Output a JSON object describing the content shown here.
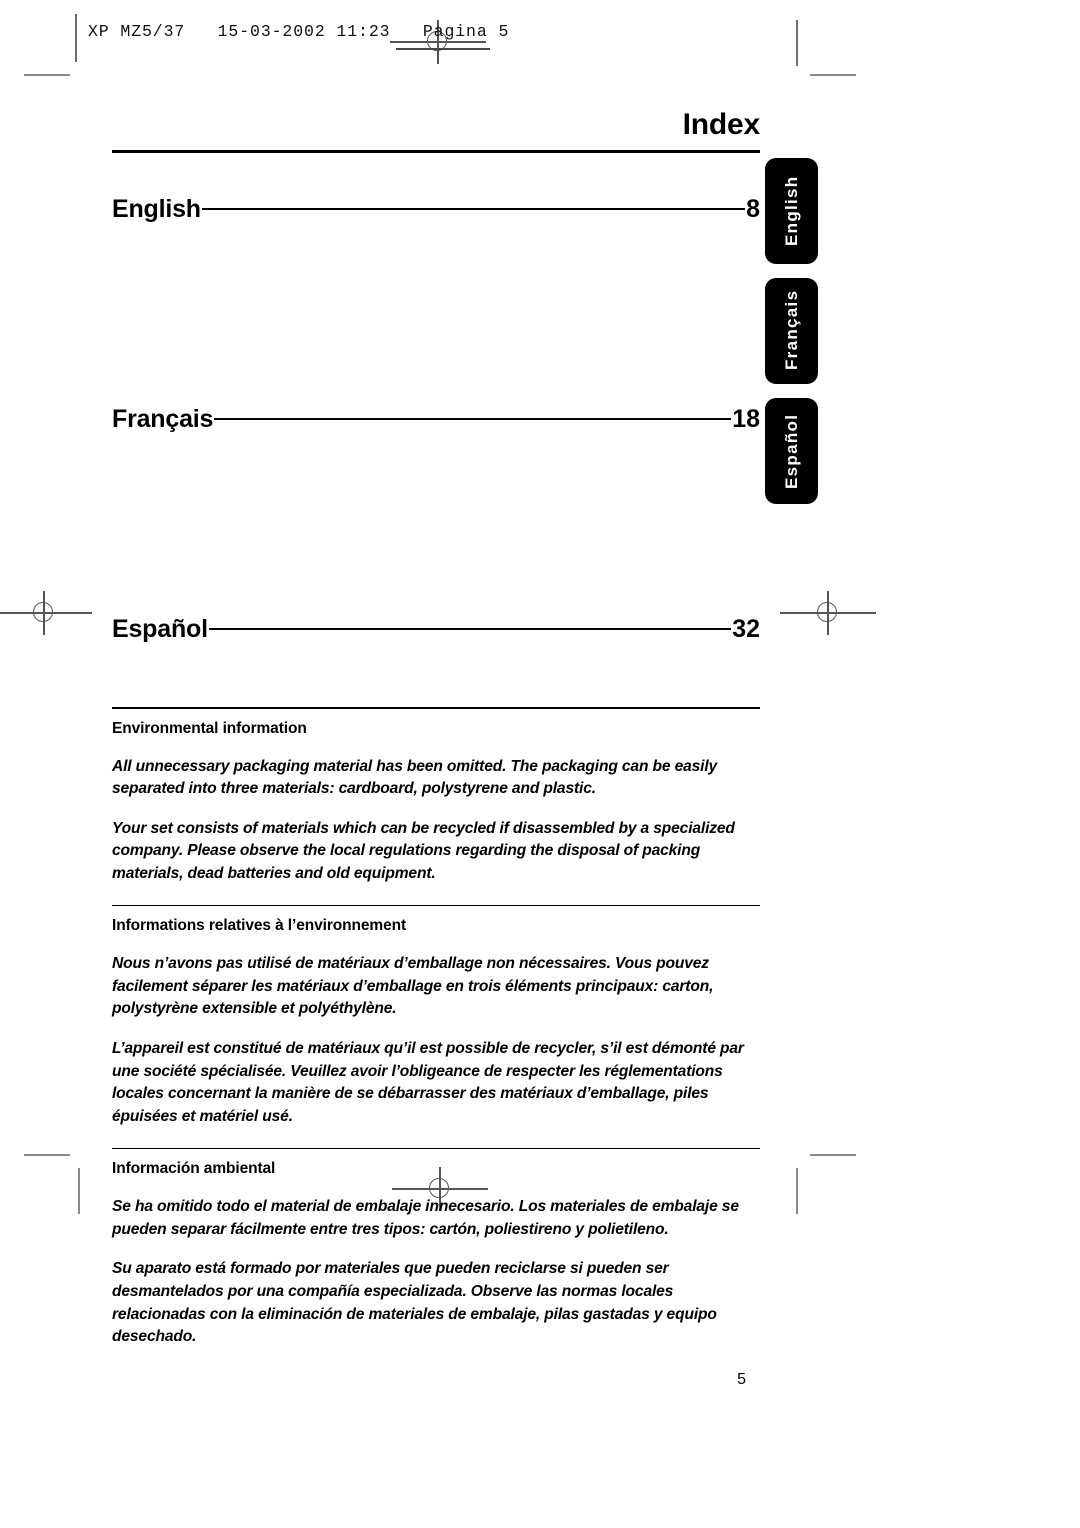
{
  "print_slug": {
    "text": "XP MZ5/37   15-03-2002 11:23   Pagina 5"
  },
  "page": {
    "title": "Index",
    "page_number": "5"
  },
  "toc": {
    "entries": [
      {
        "label": "English",
        "page": "8"
      },
      {
        "label": "Français",
        "page": "18"
      },
      {
        "label": "Español",
        "page": "32"
      }
    ]
  },
  "sections": [
    {
      "heading": "Environmental information",
      "paragraphs": [
        "All unnecessary packaging material has been omitted. The packaging can be easily separated into three materials: cardboard, polystyrene and plastic.",
        "Your set consists of materials which can be recycled if disassembled by a specialized company. Please observe the local regulations regarding the disposal of packing materials, dead batteries and old equipment."
      ]
    },
    {
      "heading": "Informations relatives à l’environnement",
      "paragraphs": [
        "Nous n’avons pas utilisé de matériaux d’emballage non nécessaires. Vous pouvez facilement séparer les matériaux d’emballage en trois éléments principaux: carton, polystyrène extensible et polyéthylène.",
        "L’appareil est constitué de matériaux qu’il est possible de recycler, s’il est démonté par une société spécialisée. Veuillez avoir l’obligeance de respecter les réglementations locales concernant la manière de se débarrasser des matériaux d’emballage, piles épuisées et matériel usé."
      ]
    },
    {
      "heading": "Información ambiental",
      "paragraphs": [
        "Se ha omitido todo el material de embalaje innecesario. Los materiales de embalaje se pueden separar fácilmente entre tres tipos:  cartón, poliestireno y polietileno.",
        "Su aparato está formado por materiales que pueden reciclarse si pueden ser desmantelados por una compañía especializada. Observe las normas locales relacionadas con la eliminación de materiales de embalaje, pilas gastadas y equipo desechado."
      ]
    }
  ],
  "side_tabs": [
    {
      "label": "English"
    },
    {
      "label": "Français"
    },
    {
      "label": "Español"
    }
  ],
  "colors": {
    "ink": "#000000",
    "paper": "#ffffff",
    "tab_background": "#000000",
    "tab_text": "#ffffff",
    "crop_mark": "#8a8a8a"
  }
}
